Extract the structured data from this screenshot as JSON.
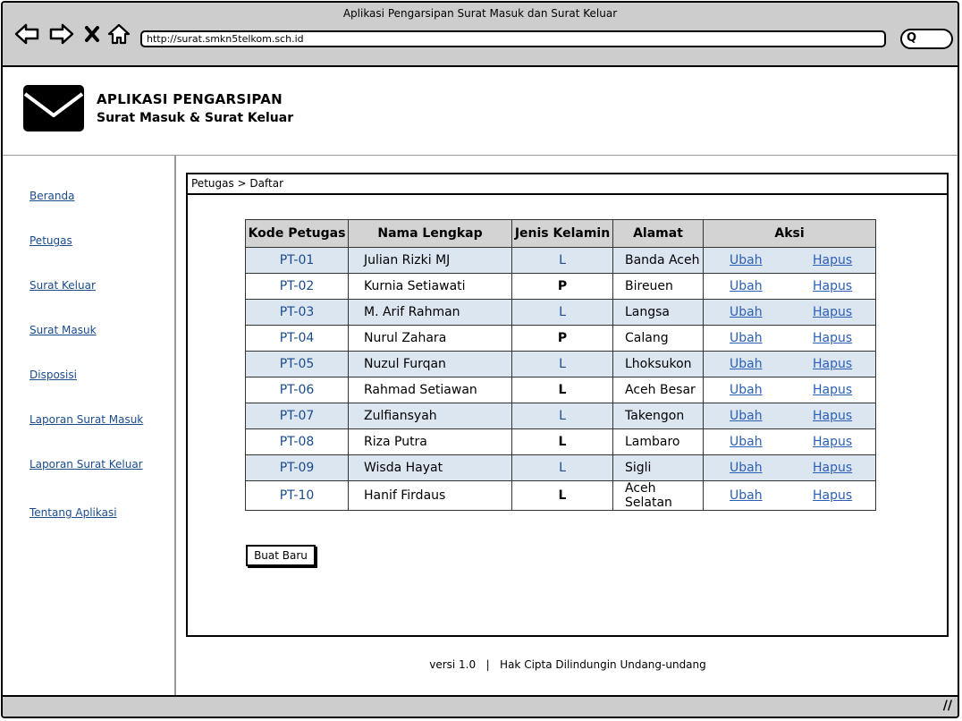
{
  "browser": {
    "window_title": "Aplikasi Pengarsipan Surat Masuk dan Surat Keluar",
    "url": "http://surat.smkn5telkom.sch.id",
    "search_glyph": "Q",
    "icons": [
      "back-arrow-icon",
      "forward-arrow-icon",
      "close-x-icon",
      "home-icon",
      "search-icon"
    ]
  },
  "header": {
    "title": "APLIKASI PENGARSIPAN",
    "subtitle": "Surat Masuk & Surat Keluar",
    "logo_icon": "envelope-icon"
  },
  "sidebar": {
    "items": [
      {
        "label": "Beranda"
      },
      {
        "label": "Petugas"
      },
      {
        "label": "Surat Keluar"
      },
      {
        "label": "Surat Masuk"
      },
      {
        "label": "Disposisi"
      },
      {
        "label": "Laporan Surat Masuk"
      },
      {
        "label": "Laporan Surat Keluar"
      },
      {
        "label": "Tentang Aplikasi"
      }
    ]
  },
  "main": {
    "breadcrumb": "Petugas > Daftar",
    "table": {
      "headers": [
        "Kode Petugas",
        "Nama Lengkap",
        "Jenis Kelamin",
        "Alamat",
        "Aksi"
      ],
      "edit_label": "Ubah",
      "delete_label": "Hapus",
      "rows": [
        {
          "kode": "PT-01",
          "nama": "Julian Rizki MJ",
          "jk": "L",
          "alamat": "Banda Aceh"
        },
        {
          "kode": "PT-02",
          "nama": "Kurnia Setiawati",
          "jk": "P",
          "alamat": "Bireuen"
        },
        {
          "kode": "PT-03",
          "nama": "M. Arif Rahman",
          "jk": "L",
          "alamat": "Langsa"
        },
        {
          "kode": "PT-04",
          "nama": "Nurul Zahara",
          "jk": "P",
          "alamat": "Calang"
        },
        {
          "kode": "PT-05",
          "nama": "Nuzul Furqan",
          "jk": "L",
          "alamat": "Lhoksukon"
        },
        {
          "kode": "PT-06",
          "nama": "Rahmad Setiawan",
          "jk": "L",
          "alamat": "Aceh Besar"
        },
        {
          "kode": "PT-07",
          "nama": "Zulfiansyah",
          "jk": "L",
          "alamat": "Takengon"
        },
        {
          "kode": "PT-08",
          "nama": "Riza Putra",
          "jk": "L",
          "alamat": "Lambaro"
        },
        {
          "kode": "PT-09",
          "nama": "Wisda Hayat",
          "jk": "L",
          "alamat": "Sigli"
        },
        {
          "kode": "PT-10",
          "nama": "Hanif Firdaus",
          "jk": "L",
          "alamat": "Aceh Selatan"
        }
      ]
    },
    "new_button": "Buat Baru"
  },
  "footer": {
    "text": "versi 1.0   |   Hak Cipta Dilindungin Undang-undang"
  },
  "status_bar": {
    "grip_glyph": "//"
  },
  "colors": {
    "chrome": "#cdcdcd",
    "link": "#1a4b8c",
    "row_alt": "#dce6f1",
    "header_bg": "#d3d3d3"
  }
}
